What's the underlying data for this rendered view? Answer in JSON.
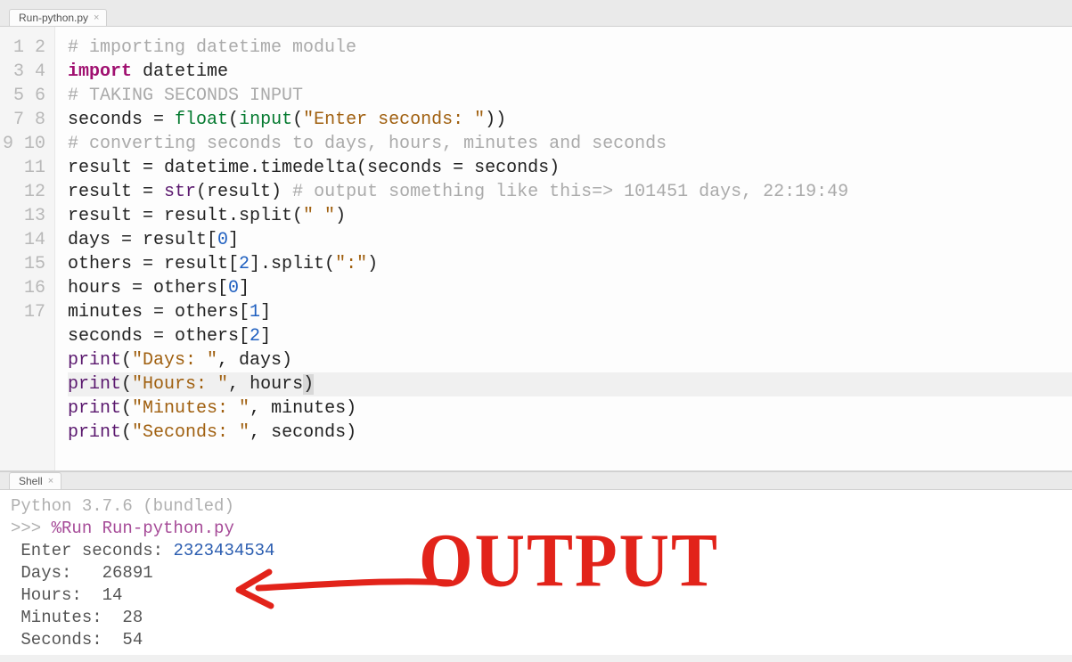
{
  "editor_tab": {
    "label": "Run-python.py",
    "close": "×"
  },
  "shell_tab": {
    "label": "Shell",
    "close": "×"
  },
  "gutter": [
    "1",
    "2",
    "3",
    "4",
    "5",
    "6",
    "7",
    "8",
    "9",
    "10",
    "11",
    "12",
    "13",
    "14",
    "15",
    "16",
    "17"
  ],
  "code": {
    "l1_comment": "# importing datetime module",
    "l2_import": "import",
    "l2_mod": " datetime",
    "l3_comment": "# TAKING SECONDS INPUT",
    "l4_a": "seconds = ",
    "l4_float": "float",
    "l4_p1": "(",
    "l4_input": "input",
    "l4_p2": "(",
    "l4_str": "\"Enter seconds: \"",
    "l4_p3": "))",
    "l5_comment": "# converting seconds to days, hours, minutes and seconds",
    "l6": "result = datetime.timedelta(seconds = seconds)",
    "l7_a": "result = ",
    "l7_str": "str",
    "l7_b": "(result) ",
    "l7_comment": "# output something like this=> 101451 days, 22:19:49",
    "l8_a": "result = result.split(",
    "l8_s": "\" \"",
    "l8_b": ")",
    "l9_a": "days = result[",
    "l9_n": "0",
    "l9_b": "]",
    "l10_a": "others = result[",
    "l10_n": "2",
    "l10_b": "].split(",
    "l10_s": "\":\"",
    "l10_c": ")",
    "l11_a": "hours = others[",
    "l11_n": "0",
    "l11_b": "]",
    "l12_a": "minutes = others[",
    "l12_n": "1",
    "l12_b": "]",
    "l13_a": "seconds = others[",
    "l13_n": "2",
    "l13_b": "]",
    "l14_p": "print",
    "l14_a": "(",
    "l14_s": "\"Days: \"",
    "l14_b": ", days)",
    "l15_p": "print",
    "l15_a": "(",
    "l15_s": "\"Hours: \"",
    "l15_b": ", hours",
    "l15_c": ")",
    "l16_p": "print",
    "l16_a": "(",
    "l16_s": "\"Minutes: \"",
    "l16_b": ", minutes)",
    "l17_p": "print",
    "l17_a": "(",
    "l17_s": "\"Seconds: \"",
    "l17_b": ", seconds)"
  },
  "shell": {
    "ver": "Python 3.7.6 (bundled)",
    "prompt": ">>> ",
    "cmd": "%Run Run-python.py",
    "l_enter_lbl": " Enter seconds: ",
    "l_enter_val": "2323434534",
    "l_days": " Days:   26891",
    "l_hours": " Hours:  14",
    "l_minutes": " Minutes:  28",
    "l_seconds": " Seconds:  54"
  },
  "annotation": "OUTPUT"
}
